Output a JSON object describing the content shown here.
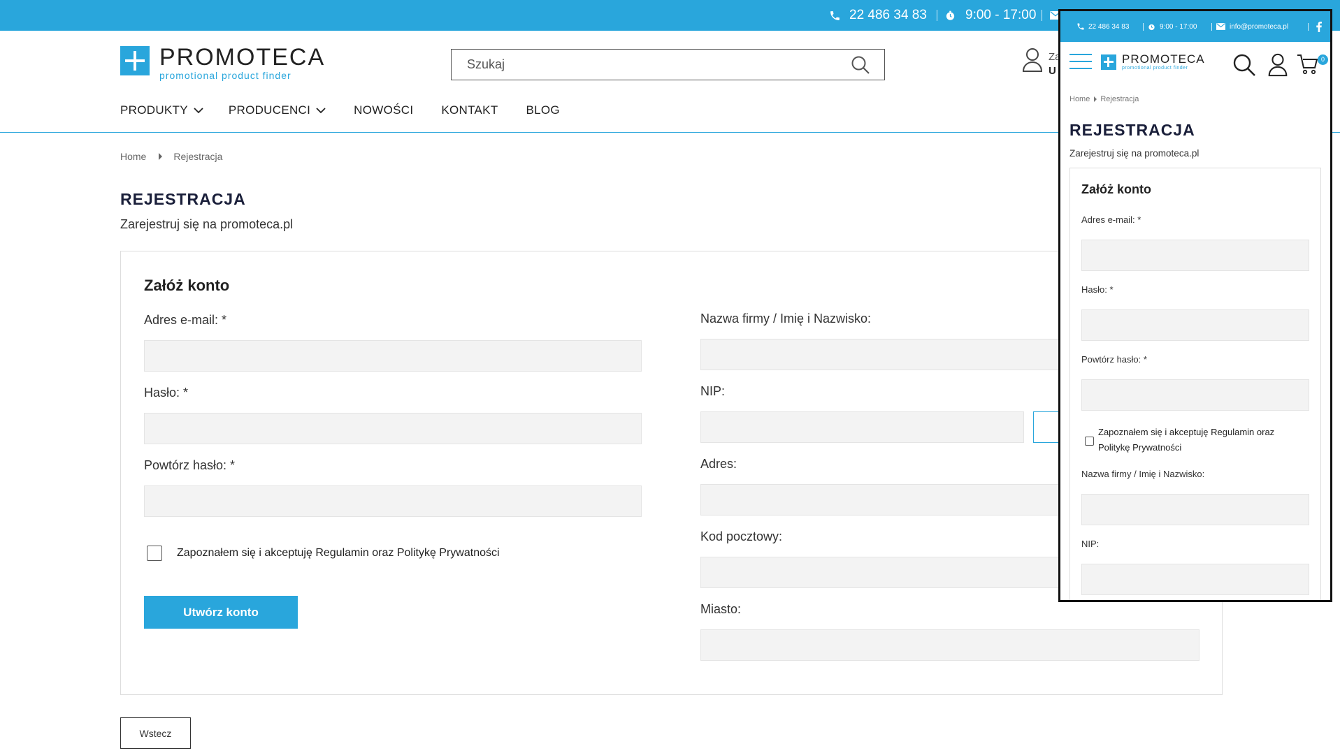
{
  "topbar": {
    "phone": "22 486 34 83",
    "hours": "9:00 - 17:00"
  },
  "brand": {
    "name": "PROMOTECA",
    "tagline": "promotional product finder",
    "accent_color": "#29a6dc"
  },
  "search": {
    "placeholder": "Szukaj"
  },
  "account": {
    "line1": "Za",
    "line2": "U"
  },
  "nav": {
    "items": [
      {
        "label": "PRODUKTY",
        "has_dropdown": true
      },
      {
        "label": "PRODUCENCI",
        "has_dropdown": true
      },
      {
        "label": "NOWOŚCI",
        "has_dropdown": false
      },
      {
        "label": "KONTAKT",
        "has_dropdown": false
      },
      {
        "label": "BLOG",
        "has_dropdown": false
      }
    ]
  },
  "breadcrumb": {
    "home": "Home",
    "current": "Rejestracja"
  },
  "page": {
    "title": "REJESTRACJA",
    "subtitle": "Zarejestruj się na promoteca.pl"
  },
  "form": {
    "title": "Załóż konto",
    "email_label": "Adres e-mail: *",
    "password_label": "Hasło: *",
    "repeat_password_label": "Powtórz hasło: *",
    "terms_label": "Zapoznałem się i akceptuję Regulamin oraz Politykę Prywatności",
    "company_label": "Nazwa firmy / Imię i Nazwisko:",
    "nip_label": "NIP:",
    "address_label": "Adres:",
    "postal_label": "Kod pocztowy:",
    "city_label": "Miasto:",
    "submit_label": "Utwórz konto",
    "back_label": "Wstecz"
  },
  "mobile": {
    "phone": "22 486 34 83",
    "hours": "9:00 - 17:00",
    "email": "info@promoteca.pl",
    "cart_count": "0",
    "breadcrumb_home": "Home",
    "breadcrumb_current": "Rejestracja",
    "title": "REJESTRACJA",
    "subtitle": "Zarejestruj się na promoteca.pl",
    "form_title": "Załóż konto",
    "email_label": "Adres e-mail: *",
    "password_label": "Hasło: *",
    "repeat_password_label": "Powtórz hasło: *",
    "terms_label": "Zapoznałem się i akceptuję Regulamin oraz Politykę Prywatności",
    "company_label": "Nazwa firmy / Imię i Nazwisko:",
    "nip_label": "NIP:"
  },
  "icons": {
    "phone": "phone-icon",
    "clock": "clock-icon",
    "mail": "mail-icon",
    "facebook": "facebook-icon",
    "search": "search-icon",
    "user": "user-icon",
    "cart": "cart-icon",
    "menu": "hamburger-menu-icon",
    "chevron": "chevron-down-icon"
  }
}
